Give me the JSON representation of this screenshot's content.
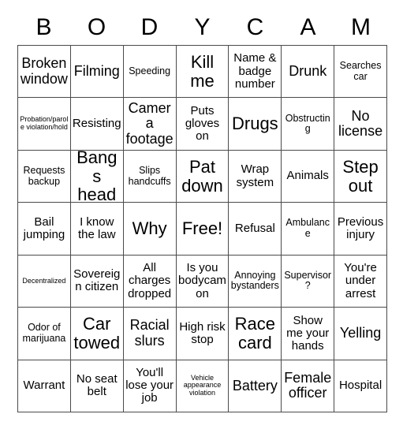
{
  "header": {
    "title": "BODYCAM",
    "letters": [
      "B",
      "O",
      "D",
      "Y",
      "C",
      "A",
      "M"
    ]
  },
  "grid": {
    "columns": 7,
    "rows": 7,
    "border_color": "#4a4a4a",
    "text_color": "#000000",
    "background_color": "#ffffff",
    "cells": [
      {
        "text": "Broken window",
        "size": "l"
      },
      {
        "text": "Filming",
        "size": "l"
      },
      {
        "text": "Speeding",
        "size": "s"
      },
      {
        "text": "Kill me",
        "size": "xl"
      },
      {
        "text": "Name & badge number",
        "size": "m"
      },
      {
        "text": "Drunk",
        "size": "l"
      },
      {
        "text": "Searches car",
        "size": "s"
      },
      {
        "text": "Probation/parole violation/hold",
        "size": "xs"
      },
      {
        "text": "Resisting",
        "size": "m"
      },
      {
        "text": "Camera footage",
        "size": "l"
      },
      {
        "text": "Puts gloves on",
        "size": "m"
      },
      {
        "text": "Drugs",
        "size": "xl"
      },
      {
        "text": "Obstructing",
        "size": "s"
      },
      {
        "text": "No license",
        "size": "l"
      },
      {
        "text": "Requests backup",
        "size": "s"
      },
      {
        "text": "Bangs head",
        "size": "xl"
      },
      {
        "text": "Slips handcuffs",
        "size": "s"
      },
      {
        "text": "Pat down",
        "size": "xl"
      },
      {
        "text": "Wrap system",
        "size": "m"
      },
      {
        "text": "Animals",
        "size": "m"
      },
      {
        "text": "Step out",
        "size": "xl"
      },
      {
        "text": "Bail jumping",
        "size": "m"
      },
      {
        "text": "I know the law",
        "size": "m"
      },
      {
        "text": "Why",
        "size": "xl"
      },
      {
        "text": "Free!",
        "size": "xl"
      },
      {
        "text": "Refusal",
        "size": "m"
      },
      {
        "text": "Ambulance",
        "size": "s"
      },
      {
        "text": "Previous injury",
        "size": "m"
      },
      {
        "text": "Decentralized",
        "size": "xs"
      },
      {
        "text": "Sovereign citizen",
        "size": "m"
      },
      {
        "text": "All charges dropped",
        "size": "m"
      },
      {
        "text": "Is you bodycam on",
        "size": "m"
      },
      {
        "text": "Annoying bystanders",
        "size": "s"
      },
      {
        "text": "Supervisor?",
        "size": "s"
      },
      {
        "text": "You're under arrest",
        "size": "m"
      },
      {
        "text": "Odor of marijuana",
        "size": "s"
      },
      {
        "text": "Car towed",
        "size": "xl"
      },
      {
        "text": "Racial slurs",
        "size": "l"
      },
      {
        "text": "High risk stop",
        "size": "m"
      },
      {
        "text": "Race card",
        "size": "xl"
      },
      {
        "text": "Show me your hands",
        "size": "m"
      },
      {
        "text": "Yelling",
        "size": "l"
      },
      {
        "text": "Warrant",
        "size": "m"
      },
      {
        "text": "No seat belt",
        "size": "m"
      },
      {
        "text": "You'll lose your job",
        "size": "m"
      },
      {
        "text": "Vehicle appearance violation",
        "size": "xs"
      },
      {
        "text": "Battery",
        "size": "l"
      },
      {
        "text": "Female officer",
        "size": "l"
      },
      {
        "text": "Hospital",
        "size": "m"
      }
    ]
  }
}
